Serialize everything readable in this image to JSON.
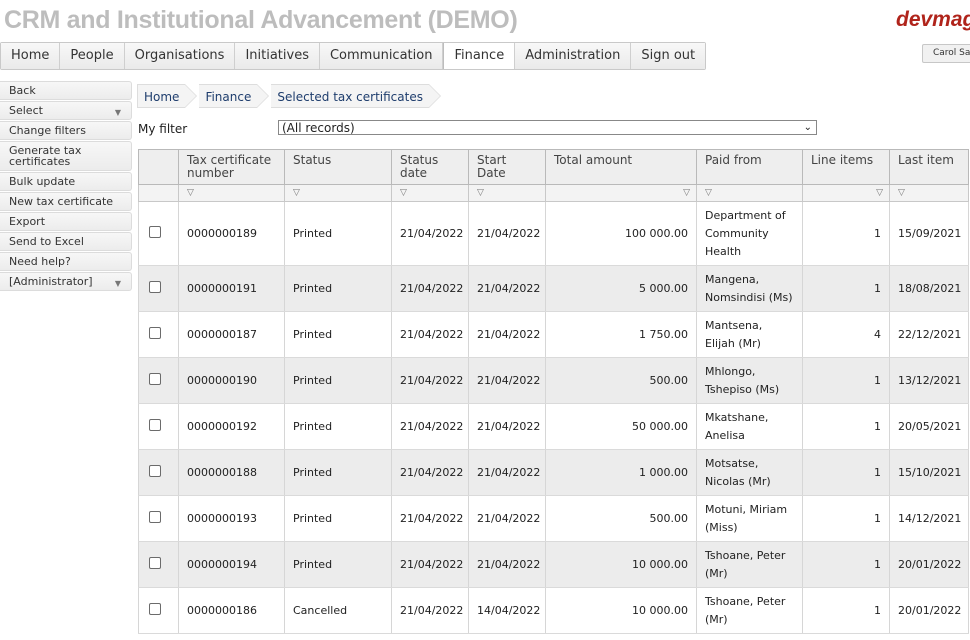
{
  "app": {
    "title": "CRM and Institutional Advancement (DEMO)",
    "logo": "devmag",
    "user": "Carol Saunders"
  },
  "topnav": [
    "Home",
    "People",
    "Organisations",
    "Initiatives",
    "Communication",
    "Finance",
    "Administration",
    "Sign out"
  ],
  "active_tab": "Finance",
  "sidemenu": [
    {
      "label": "Back"
    },
    {
      "label": "Select",
      "dropdown": true
    },
    {
      "label": "Change filters"
    },
    {
      "label": "Generate tax certificates"
    },
    {
      "label": "Bulk update"
    },
    {
      "label": "New tax certificate"
    },
    {
      "label": "Export"
    },
    {
      "label": "Send to Excel"
    },
    {
      "label": "Need help?"
    },
    {
      "label": "[Administrator]",
      "dropdown": true
    }
  ],
  "breadcrumb": [
    "Home",
    "Finance",
    "Selected tax certificates"
  ],
  "filter": {
    "label": "My filter",
    "value": "(All records)"
  },
  "table": {
    "columns": [
      "",
      "Tax certificate number",
      "Status",
      "Status date",
      "Start Date",
      "Total amount",
      "Paid from",
      "Line items",
      "Last item"
    ],
    "rows": [
      {
        "number": "0000000189",
        "status": "Printed",
        "status_date": "21/04/2022",
        "start_date": "21/04/2022",
        "total": "100 000.00",
        "paid_from": "Department of Community Health",
        "line_items": "1",
        "last_item": "15/09/2021"
      },
      {
        "number": "0000000191",
        "status": "Printed",
        "status_date": "21/04/2022",
        "start_date": "21/04/2022",
        "total": "5 000.00",
        "paid_from": "Mangena, Nomsindisi (Ms)",
        "line_items": "1",
        "last_item": "18/08/2021"
      },
      {
        "number": "0000000187",
        "status": "Printed",
        "status_date": "21/04/2022",
        "start_date": "21/04/2022",
        "total": "1 750.00",
        "paid_from": "Mantsena, Elijah (Mr)",
        "line_items": "4",
        "last_item": "22/12/2021"
      },
      {
        "number": "0000000190",
        "status": "Printed",
        "status_date": "21/04/2022",
        "start_date": "21/04/2022",
        "total": "500.00",
        "paid_from": "Mhlongo, Tshepiso (Ms)",
        "line_items": "1",
        "last_item": "13/12/2021"
      },
      {
        "number": "0000000192",
        "status": "Printed",
        "status_date": "21/04/2022",
        "start_date": "21/04/2022",
        "total": "50 000.00",
        "paid_from": "Mkatshane, Anelisa",
        "line_items": "1",
        "last_item": "20/05/2021"
      },
      {
        "number": "0000000188",
        "status": "Printed",
        "status_date": "21/04/2022",
        "start_date": "21/04/2022",
        "total": "1 000.00",
        "paid_from": "Motsatse, Nicolas (Mr)",
        "line_items": "1",
        "last_item": "15/10/2021"
      },
      {
        "number": "0000000193",
        "status": "Printed",
        "status_date": "21/04/2022",
        "start_date": "21/04/2022",
        "total": "500.00",
        "paid_from": "Motuni, Miriam (Miss)",
        "line_items": "1",
        "last_item": "14/12/2021"
      },
      {
        "number": "0000000194",
        "status": "Printed",
        "status_date": "21/04/2022",
        "start_date": "21/04/2022",
        "total": "10 000.00",
        "paid_from": "Tshoane, Peter (Mr)",
        "line_items": "1",
        "last_item": "20/01/2022"
      },
      {
        "number": "0000000186",
        "status": "Cancelled",
        "status_date": "21/04/2022",
        "start_date": "14/04/2022",
        "total": "10 000.00",
        "paid_from": "Tshoane, Peter (Mr)",
        "line_items": "1",
        "last_item": "20/01/2022"
      }
    ]
  },
  "icons": {
    "filter": "funnel-icon",
    "dropdown": "caret-down-icon"
  },
  "colors": {
    "title": "#bdbdbd",
    "logo": "#b0241b",
    "link": "#1e3d6d",
    "row_alt": "#ececec"
  }
}
